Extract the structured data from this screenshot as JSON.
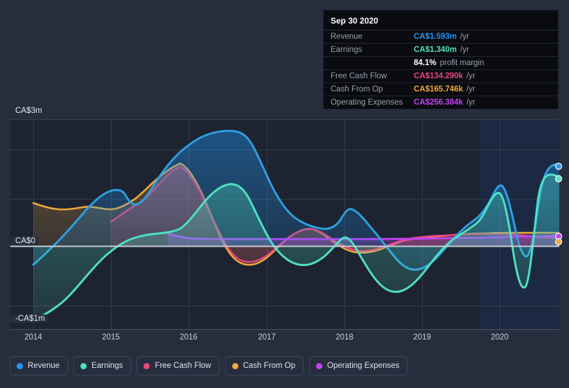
{
  "tooltip": {
    "date": "Sep 30 2020",
    "rows": [
      {
        "label": "Revenue",
        "value": "CA$1.593m",
        "unit": "/yr",
        "color": "#2196f3"
      },
      {
        "label": "Earnings",
        "value": "CA$1.340m",
        "unit": "/yr",
        "color": "#4fe0c0"
      },
      {
        "label": "",
        "value": "84.1%",
        "unit": "",
        "sub": "profit margin",
        "color": "#ffffff"
      },
      {
        "label": "Free Cash Flow",
        "value": "CA$134.290k",
        "unit": "/yr",
        "color": "#e8457c"
      },
      {
        "label": "Cash From Op",
        "value": "CA$165.746k",
        "unit": "/yr",
        "color": "#f0a93c"
      },
      {
        "label": "Operating Expenses",
        "value": "CA$256.384k",
        "unit": "/yr",
        "color": "#c343f5"
      }
    ]
  },
  "legend": [
    {
      "label": "Revenue",
      "color": "#2196f3"
    },
    {
      "label": "Earnings",
      "color": "#4fe0c0"
    },
    {
      "label": "Free Cash Flow",
      "color": "#e8457c"
    },
    {
      "label": "Cash From Op",
      "color": "#f0a93c"
    },
    {
      "label": "Operating Expenses",
      "color": "#c343f5"
    }
  ],
  "chart_data": {
    "type": "area",
    "title": "",
    "xlabel": "",
    "ylabel": "",
    "currency": "CA$",
    "grid": true,
    "legend_position": "bottom",
    "ylim": [
      -1.35,
      3.3
    ],
    "yticks": [
      3,
      0,
      -1
    ],
    "ytick_labels": [
      "CA$3m",
      "CA$0",
      "-CA$1m"
    ],
    "xlim": [
      2013.75,
      2021.3
    ],
    "xticks": [
      2014,
      2015,
      2016,
      2017,
      2018,
      2019,
      2020
    ],
    "xtick_labels": [
      "2014",
      "2015",
      "2016",
      "2017",
      "2018",
      "2019",
      "2020"
    ],
    "forecast_start": 2020.05,
    "x": [
      2014.0,
      2014.25,
      2014.5,
      2014.75,
      2015.0,
      2015.25,
      2015.5,
      2015.75,
      2016.0,
      2016.25,
      2016.5,
      2016.75,
      2017.0,
      2017.25,
      2017.5,
      2017.75,
      2018.0,
      2018.25,
      2018.5,
      2018.75,
      2019.0,
      2019.25,
      2019.5,
      2019.75,
      2020.0,
      2020.25,
      2020.5,
      2020.75,
      2021.0,
      2021.2
    ],
    "series": [
      {
        "name": "Revenue",
        "color": "#2196f3",
        "values": [
          -0.45,
          -0.1,
          0.25,
          0.62,
          0.95,
          1.05,
          0.98,
          1.22,
          1.55,
          1.8,
          1.95,
          2.05,
          1.85,
          1.35,
          1.02,
          0.78,
          0.72,
          1.0,
          0.62,
          0.05,
          -0.22,
          0.05,
          0.35,
          0.3,
          0.15,
          1.18,
          0.55,
          -0.12,
          1.55,
          1.6
        ]
      },
      {
        "name": "Earnings",
        "color": "#4fe0c0",
        "values": [
          -0.98,
          -0.88,
          -0.7,
          -0.45,
          -0.18,
          0.18,
          0.42,
          0.46,
          0.48,
          0.66,
          0.88,
          0.85,
          0.62,
          0.22,
          0.02,
          0.0,
          0.18,
          0.4,
          0.1,
          -0.28,
          -0.52,
          -0.3,
          -0.12,
          -0.14,
          -0.05,
          0.82,
          0.18,
          -0.46,
          1.3,
          1.35
        ]
      },
      {
        "name": "Free Cash Flow",
        "color": "#e8457c",
        "values": [
          null,
          null,
          null,
          null,
          null,
          null,
          0.18,
          0.42,
          0.68,
          0.95,
          1.12,
          0.88,
          0.42,
          -0.05,
          -0.22,
          -0.24,
          -0.1,
          0.18,
          0.26,
          0.08,
          -0.16,
          -0.22,
          -0.12,
          0.02,
          0.05,
          0.1,
          0.12,
          0.14,
          0.13,
          0.13
        ]
      },
      {
        "name": "Cash From Op",
        "color": "#f0a93c",
        "values": [
          0.58,
          0.5,
          0.45,
          0.48,
          0.52,
          0.42,
          0.4,
          0.62,
          0.88,
          1.08,
          1.25,
          0.98,
          0.5,
          -0.02,
          -0.2,
          -0.22,
          -0.06,
          0.22,
          0.3,
          0.1,
          -0.12,
          -0.16,
          -0.06,
          0.06,
          0.08,
          0.12,
          0.14,
          0.16,
          0.16,
          0.16
        ]
      },
      {
        "name": "Operating Expenses",
        "color": "#c343f5",
        "values": [
          null,
          null,
          null,
          0.22,
          0.14,
          0.13,
          0.13,
          0.13,
          0.13,
          0.13,
          0.13,
          0.13,
          0.14,
          0.14,
          0.15,
          0.16,
          0.17,
          0.18,
          0.19,
          0.2,
          0.21,
          0.22,
          0.22,
          0.23,
          0.24,
          0.25,
          0.25,
          0.26,
          0.26,
          0.26
        ]
      }
    ]
  }
}
